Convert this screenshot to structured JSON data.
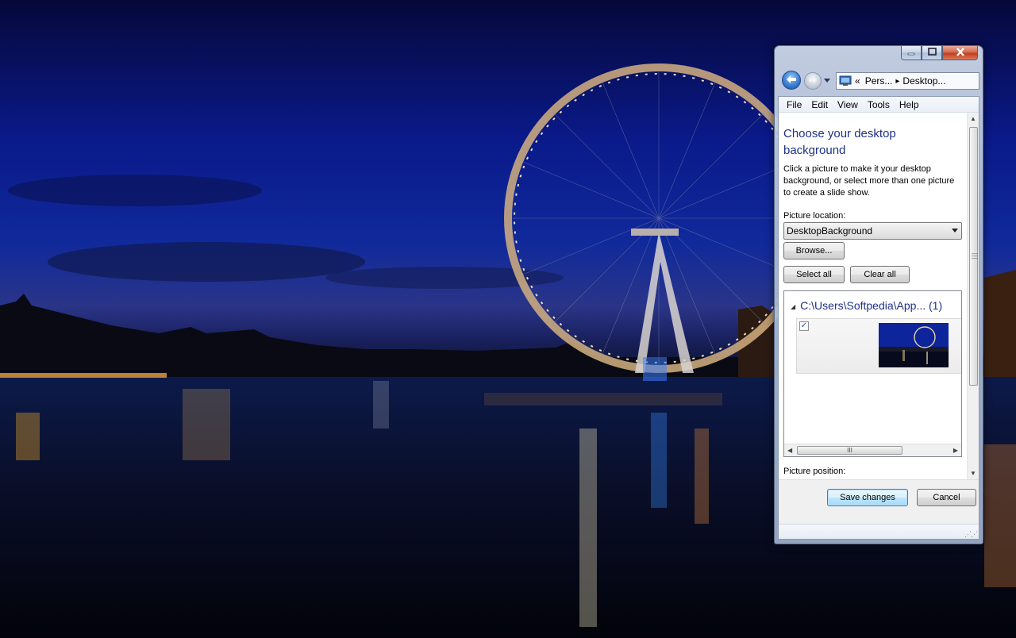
{
  "wallpaper": {
    "name": "London Eye at night",
    "colors": {
      "sky_top": "#06083a",
      "sky_mid": "#10299b",
      "water": "#050812"
    }
  },
  "window": {
    "caption_buttons": {
      "minimize_icon": "minimize-icon",
      "maximize_icon": "maximize-icon",
      "close_icon": "close-icon"
    },
    "nav": {
      "back_icon": "back-arrow-icon",
      "forward_icon": "forward-arrow-icon",
      "address": {
        "prefix": "«",
        "segment1": "Pers...",
        "separator": "▸",
        "segment2": "Desktop..."
      }
    },
    "menu": [
      "File",
      "Edit",
      "View",
      "Tools",
      "Help"
    ],
    "content": {
      "title": "Choose your desktop background",
      "description": "Click a picture to make it your desktop background, or select more than one picture to create a slide show.",
      "picture_location_label": "Picture location:",
      "picture_location_value": "DesktopBackground",
      "browse_label": "Browse...",
      "select_all_label": "Select all",
      "clear_all_label": "Clear all",
      "group": {
        "path": "C:\\Users\\Softpedia\\App...",
        "count": "(1)"
      },
      "thumbnail": {
        "checked": true,
        "check_glyph": "✓"
      },
      "picture_position_label": "Picture position:"
    },
    "footer": {
      "save_label": "Save changes",
      "cancel_label": "Cancel"
    },
    "scroll_glyphs": {
      "up": "▲",
      "down": "▼",
      "left": "◀",
      "right": "▶",
      "grip": "III"
    }
  }
}
